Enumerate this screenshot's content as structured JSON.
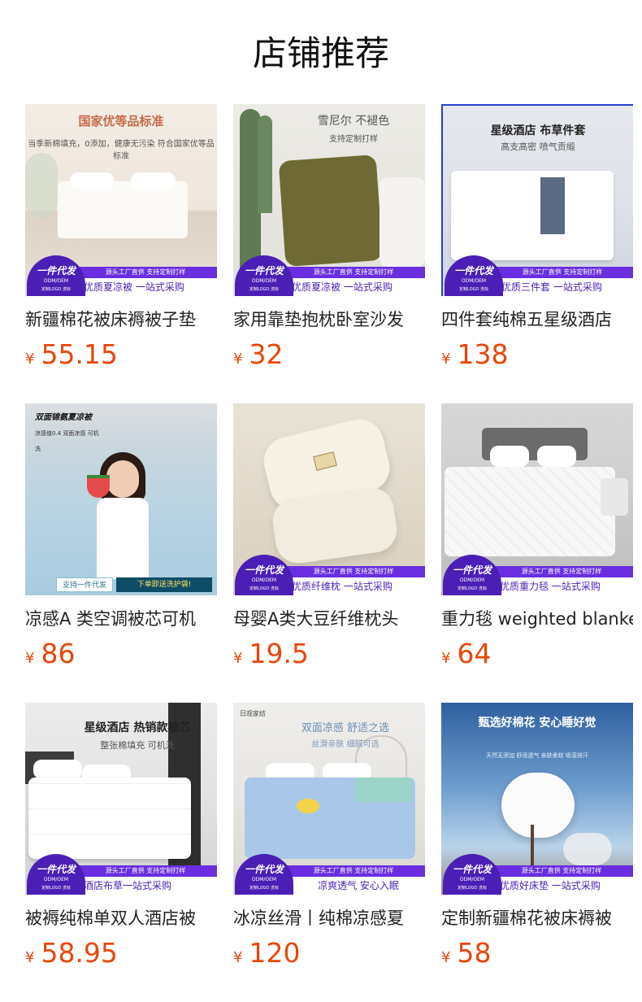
{
  "page_title": "店铺推荐",
  "currency": "¥",
  "badge": {
    "main": "一件代发",
    "odm": "ODM/OEM",
    "logo": "定制LOGO 洗标",
    "factory": "源头工厂直供  支持定制打样"
  },
  "products": [
    {
      "title": "新疆棉花被床褥被子垫",
      "price": "55.15",
      "headline": "国家优等品标准",
      "sub": "当季新棉填充，0添加，健康无污染 符合国家优等品标准",
      "tag": "优质夏凉被  一站式采购"
    },
    {
      "title": "家用靠垫抱枕卧室沙发",
      "price": "32",
      "headline": "雪尼尔  不褪色",
      "sub": "支持定制打样",
      "tag": "优质夏凉被  一站式采购"
    },
    {
      "title": "四件套纯棉五星级酒店",
      "price": "138",
      "headline": "星级酒店  布草件套",
      "sub": "高支高密  喷气贡缎",
      "tag": "优质三件套  一站式采购"
    },
    {
      "title": "凉感A 类空调被芯可机",
      "price": "86",
      "headline": "双面锦氨夏凉被",
      "sub": "凉感值0.4  双面凉感  可机洗",
      "tag_left": "支持一件代发",
      "tag_right": "下单即送洗护袋!"
    },
    {
      "title": "母婴A类大豆纤维枕头",
      "price": "19.5",
      "headline": "",
      "sub": "",
      "tag": "优质纤维枕  一站式采购"
    },
    {
      "title": "重力毯 weighted blanket",
      "price": "64",
      "headline": "",
      "sub": "",
      "tag": "优质重力毯  一站式采购"
    },
    {
      "title": "被褥纯棉单双人酒店被",
      "price": "58.95",
      "headline": "星级酒店  热销款被芯",
      "sub": "整张棉填充  可机洗",
      "tag": "酒店布草一站式采购"
    },
    {
      "title": "冰凉丝滑丨纯棉凉感夏",
      "price": "120",
      "headline": "双面凉感  舒适之选",
      "sub": "丝滑亲肤  细腻可选",
      "tag": "凉爽透气  安心入眠"
    },
    {
      "title": "定制新疆棉花被床褥被",
      "price": "58",
      "headline": "甄选好棉花  安心睡好觉",
      "sub": "天然无添加  舒适透气  亲肤柔软  吸湿排汗",
      "tag": "优质好床垫  一站式采购"
    }
  ]
}
